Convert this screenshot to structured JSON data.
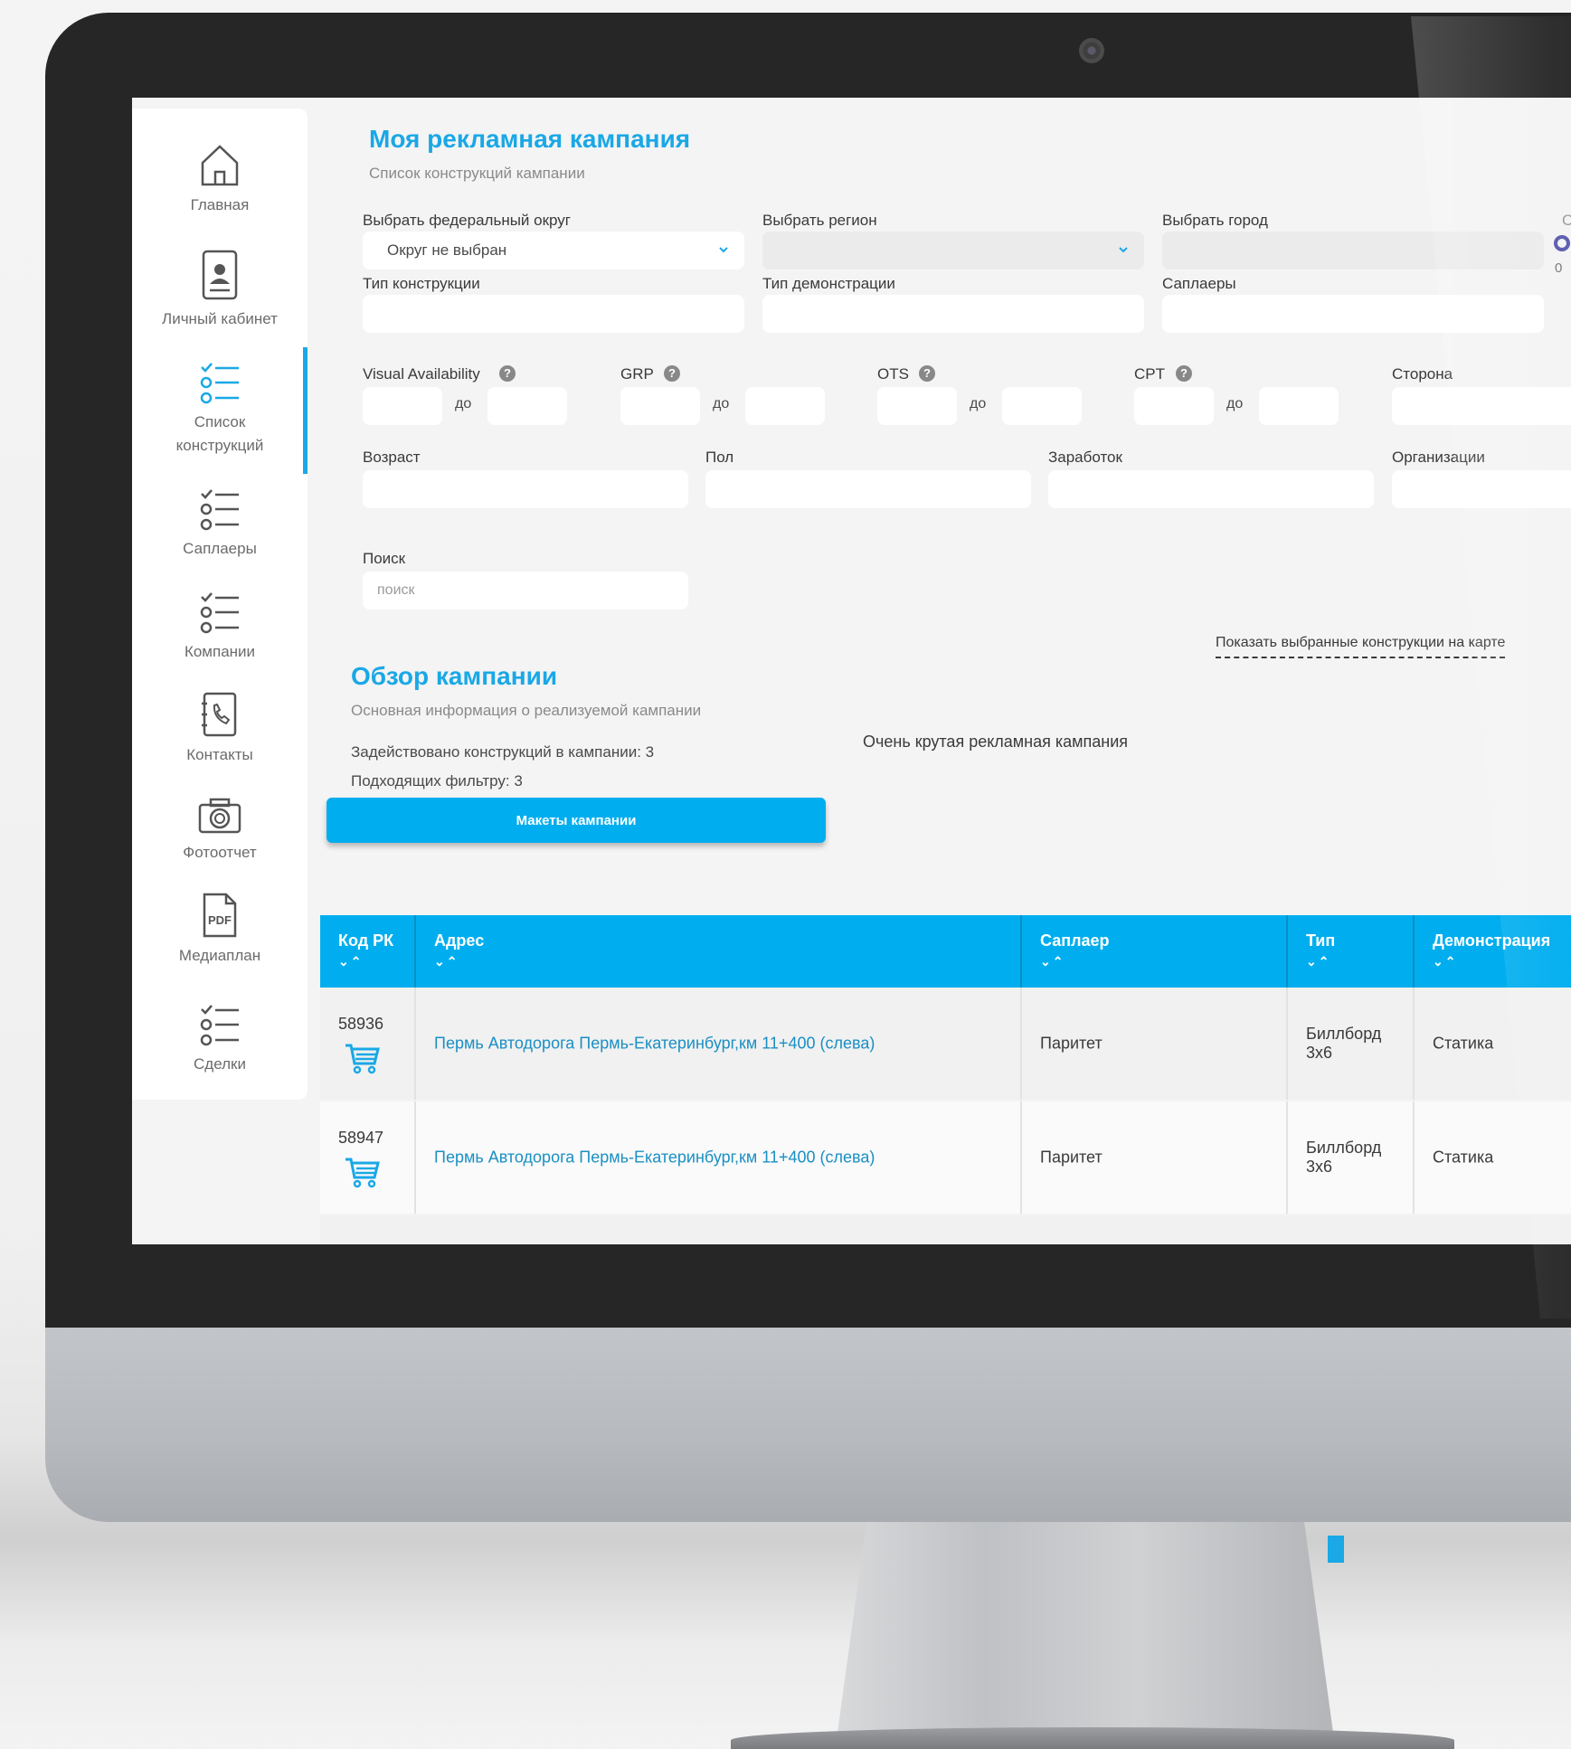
{
  "sidebar": {
    "items": [
      {
        "label": "Главная",
        "icon": "home-icon"
      },
      {
        "label": "Личный кабинет",
        "icon": "profile-icon"
      },
      {
        "label": "Список конструкций",
        "icon": "checklist-icon",
        "active": true
      },
      {
        "label": "Саплаеры",
        "icon": "checklist-icon"
      },
      {
        "label": "Компании",
        "icon": "checklist-icon"
      },
      {
        "label": "Контакты",
        "icon": "phone-book-icon"
      },
      {
        "label": "Фотоотчет",
        "icon": "camera-icon"
      },
      {
        "label": "Медиаплан",
        "icon": "pdf-icon"
      },
      {
        "label": "Сделки",
        "icon": "checklist-icon"
      }
    ]
  },
  "page": {
    "title": "Моя рекламная кампания",
    "subtitle": "Список конструкций кампании"
  },
  "filters": {
    "federal_district_label": "Выбрать федеральный округ",
    "federal_district_value": "Округ не выбран",
    "region_label": "Выбрать регион",
    "city_label": "Выбрать город",
    "construction_type_label": "Тип конструкции",
    "demo_type_label": "Тип демонстрации",
    "suppliers_label": "Саплаеры",
    "visual_availability_label": "Visual Availability",
    "grp_label": "GRP",
    "ots_label": "OTS",
    "cpt_label": "CPT",
    "side_label": "Сторона",
    "to_label": "до",
    "age_label": "Возраст",
    "gender_label": "Пол",
    "income_label": "Заработок",
    "organizations_label": "Организации",
    "search_label": "Поиск",
    "search_placeholder": "поиск",
    "edge_letter": "С",
    "edge_value": "0"
  },
  "map_link": "Показать выбранные конструкции на карте",
  "overview": {
    "title": "Обзор кампании",
    "subtitle": "Основная информация о реализуемой кампании",
    "used_count": "Задействовано конструкций в кампании: 3",
    "matching_count": "Подходящих фильтру: 3",
    "description": "Очень крутая рекламная кампания",
    "layouts_button": "Макеты кампании"
  },
  "table": {
    "sort_glyphs": "⌄⌃",
    "columns": [
      "Код РК",
      "Адрес",
      "Саплаер",
      "Тип",
      "Демонстрация"
    ],
    "rows": [
      {
        "code": "58936",
        "address": "Пермь Автодорога Пермь-Екатеринбург,км 11+400 (слева)",
        "supplier": "Паритет",
        "type": "Биллборд 3х6",
        "demo": "Статика"
      },
      {
        "code": "58947",
        "address": "Пермь Автодорога Пермь-Екатеринбург,км 11+400 (слева)",
        "supplier": "Паритет",
        "type": "Биллборд 3х6",
        "demo": "Статика"
      }
    ]
  },
  "colors": {
    "accent": "#00aeef",
    "title": "#1aa8e6",
    "bezel": "#262626"
  }
}
